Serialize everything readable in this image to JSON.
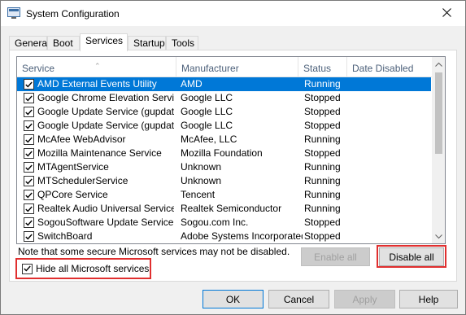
{
  "window": {
    "title": "System Configuration"
  },
  "tabs": [
    "General",
    "Boot",
    "Services",
    "Startup",
    "Tools"
  ],
  "active_tab": "Services",
  "columns": [
    "Service",
    "Manufacturer",
    "Status",
    "Date Disabled"
  ],
  "services": [
    {
      "name": "AMD External Events Utility",
      "manufacturer": "AMD",
      "status": "Running",
      "checked": true,
      "selected": true
    },
    {
      "name": "Google Chrome Elevation Service",
      "manufacturer": "Google LLC",
      "status": "Stopped",
      "checked": true
    },
    {
      "name": "Google Update Service (gupdate)",
      "manufacturer": "Google LLC",
      "status": "Stopped",
      "checked": true
    },
    {
      "name": "Google Update Service (gupdatem)",
      "manufacturer": "Google LLC",
      "status": "Stopped",
      "checked": true
    },
    {
      "name": "McAfee WebAdvisor",
      "manufacturer": "McAfee, LLC",
      "status": "Running",
      "checked": true
    },
    {
      "name": "Mozilla Maintenance Service",
      "manufacturer": "Mozilla Foundation",
      "status": "Stopped",
      "checked": true
    },
    {
      "name": "MTAgentService",
      "manufacturer": "Unknown",
      "status": "Running",
      "checked": true
    },
    {
      "name": "MTSchedulerService",
      "manufacturer": "Unknown",
      "status": "Running",
      "checked": true
    },
    {
      "name": "QPCore Service",
      "manufacturer": "Tencent",
      "status": "Running",
      "checked": true
    },
    {
      "name": "Realtek Audio Universal Service",
      "manufacturer": "Realtek Semiconductor",
      "status": "Running",
      "checked": true
    },
    {
      "name": "SogouSoftware Update Service ...",
      "manufacturer": "Sogou.com Inc.",
      "status": "Stopped",
      "checked": true
    },
    {
      "name": "SwitchBoard",
      "manufacturer": "Adobe Systems Incorporated",
      "status": "Stopped",
      "checked": true
    }
  ],
  "note": "Note that some secure Microsoft services may not be disabled.",
  "buttons": {
    "enable_all": "Enable all",
    "disable_all": "Disable all",
    "ok": "OK",
    "cancel": "Cancel",
    "apply": "Apply",
    "help": "Help"
  },
  "hide_ms": {
    "label": "Hide all Microsoft services",
    "checked": true
  },
  "colors": {
    "selection": "#0078d7",
    "highlight": "#e02f2f"
  }
}
